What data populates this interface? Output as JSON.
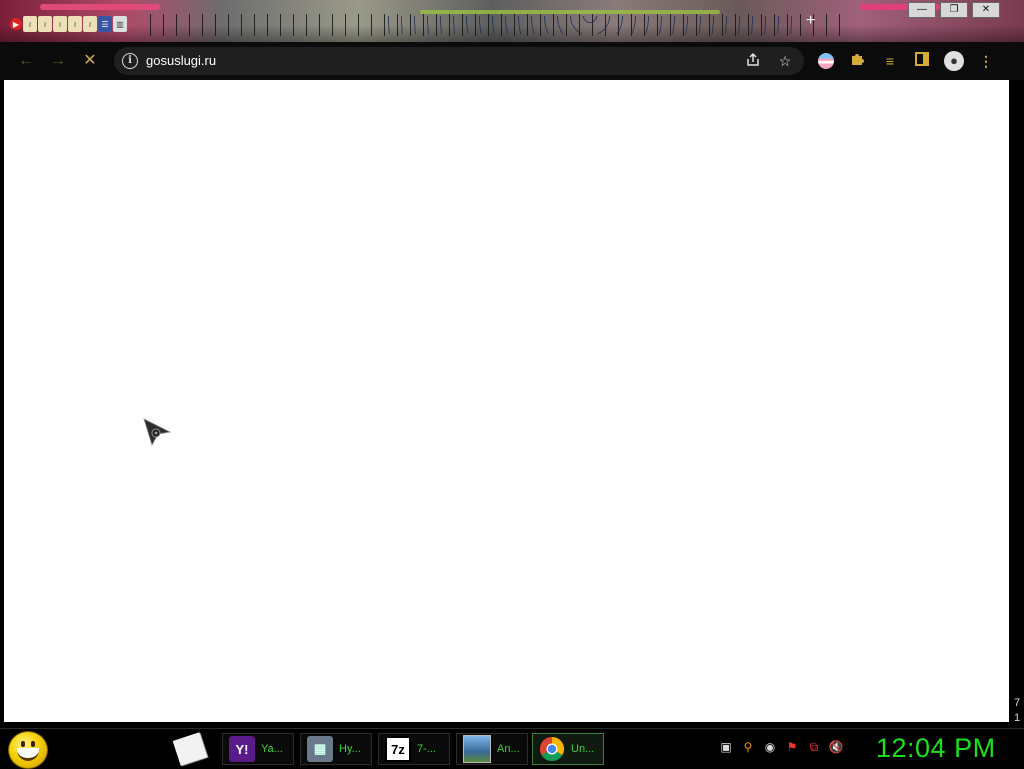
{
  "window": {
    "pinned_tabs": [
      "youtube-icon",
      "rss-icon",
      "rss-icon",
      "rss-icon",
      "rss-icon",
      "rss-icon",
      "list-icon",
      "trash-icon"
    ],
    "controls": {
      "minimize": "—",
      "maximize": "❐",
      "close": "✕"
    },
    "new_tab": "+"
  },
  "toolbar": {
    "back_icon": "arrow-left-icon",
    "forward_icon": "arrow-right-icon",
    "stop_icon": "close-icon",
    "url": "gosuslugi.ru",
    "info_glyph": "i",
    "share_icon": "share-icon",
    "bookmark_icon": "star-icon",
    "extensions": [
      "flag-extension-icon",
      "puzzle-icon",
      "media-queue-icon",
      "side-panel-icon",
      "avatar-icon",
      "kebab-menu-icon"
    ]
  },
  "content": {
    "side_numbers": [
      "7",
      "1"
    ]
  },
  "taskbar": {
    "start_icon": "smiley-icon",
    "tasks": [
      {
        "icon": "yahoo-messenger-icon",
        "label": "Ya..."
      },
      {
        "icon": "hyper-tool-icon",
        "label": "Hy..."
      },
      {
        "icon": "7zip-icon",
        "label": "7-..."
      },
      {
        "icon": "image-viewer-icon",
        "label": "An..."
      },
      {
        "icon": "chrome-icon",
        "label": "Un..."
      }
    ],
    "tray_icons": [
      "screen-icon",
      "search-icon",
      "network-icon",
      "flag-icon",
      "remote-icon",
      "volume-muted-icon"
    ],
    "clock": "12:04 PM"
  },
  "colors": {
    "clock": "#19e119",
    "task_label": "#39d439",
    "toolbar_accent": "#d4aa3a",
    "omnibox_bg": "#1f1f1f"
  }
}
